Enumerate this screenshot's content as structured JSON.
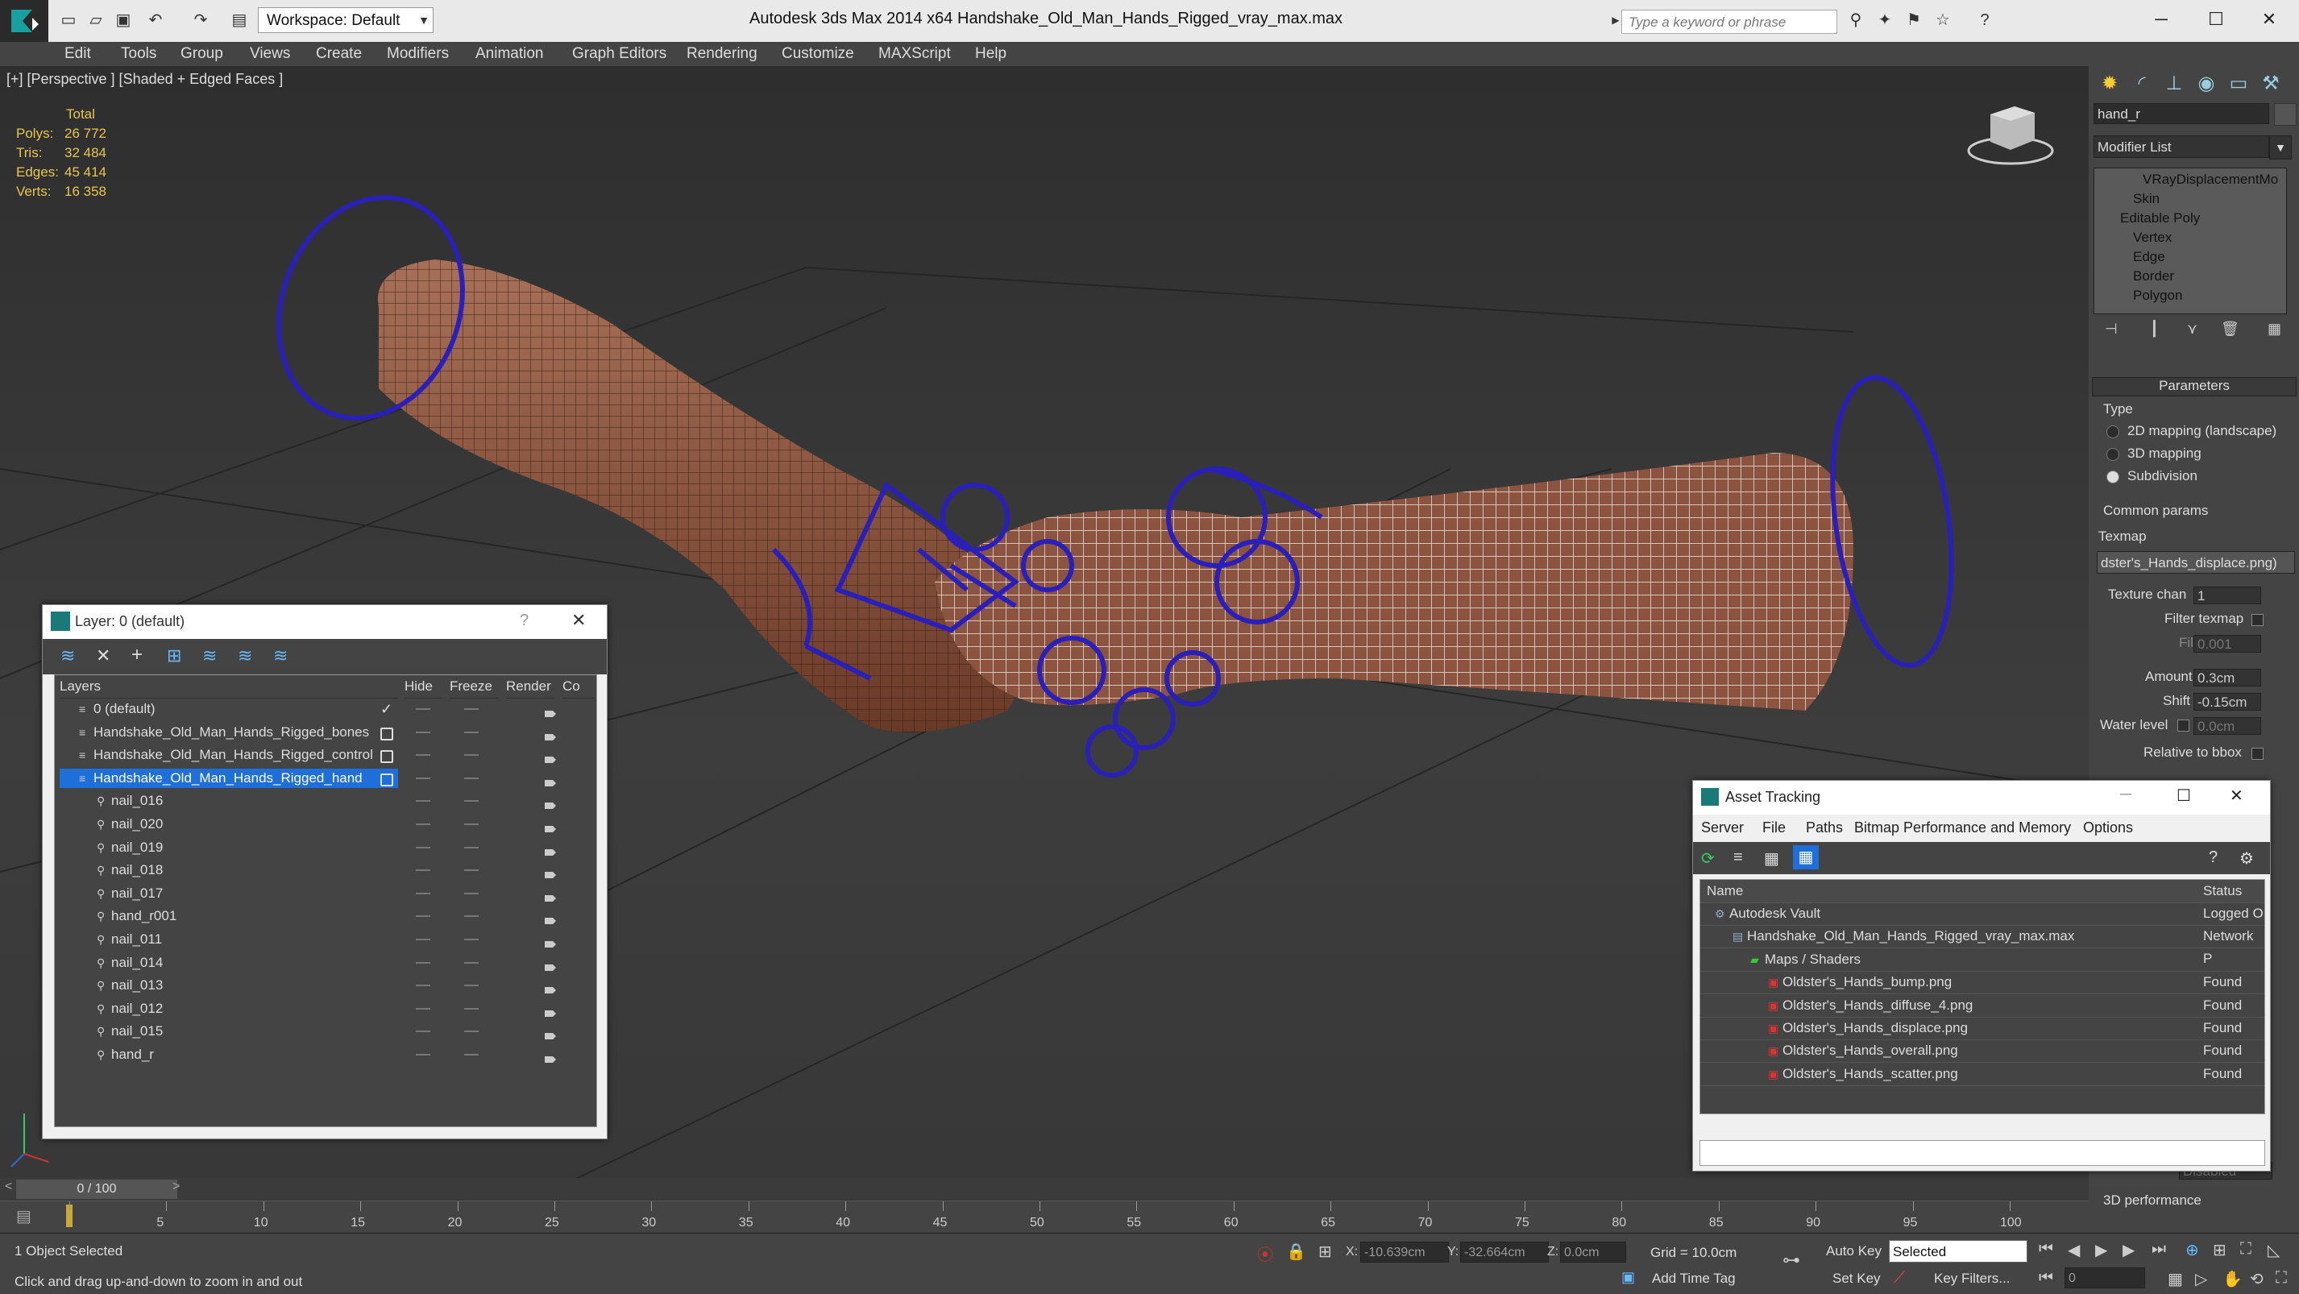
{
  "window": {
    "app_title": "Autodesk 3ds Max  2014 x64",
    "file_title": "Handshake_Old_Man_Hands_Rigged_vray_max.max",
    "workspace_label": "Workspace: Default",
    "search_placeholder": "Type a keyword or phrase"
  },
  "menu": [
    "Edit",
    "Tools",
    "Group",
    "Views",
    "Create",
    "Modifiers",
    "Animation",
    "Graph Editors",
    "Rendering",
    "Customize",
    "MAXScript",
    "Help"
  ],
  "viewport": {
    "label": "[+] [Perspective ] [Shaded + Edged Faces ]",
    "stats": {
      "header": "Total",
      "rows": [
        {
          "key": "Polys:",
          "value": "26 772"
        },
        {
          "key": "Tris:",
          "value": "32 484"
        },
        {
          "key": "Edges:",
          "value": "45 414"
        },
        {
          "key": "Verts:",
          "value": "16 358"
        }
      ]
    }
  },
  "command_panel": {
    "object_name": "hand_r",
    "modifier_list": "Modifier List",
    "stack": [
      "VRayDisplacementMo",
      "Skin",
      "Editable Poly",
      "Vertex",
      "Edge",
      "Border",
      "Polygon"
    ],
    "parameters_title": "Parameters",
    "type_label": "Type",
    "type_options": [
      "2D mapping (landscape)",
      "3D mapping",
      "Subdivision"
    ],
    "common_params": "Common params",
    "texmap_label": "Texmap",
    "texmap_value": "dster's_Hands_displace.png)",
    "texture_chan_label": "Texture chan",
    "texture_chan_value": "1",
    "filter_texmap": "Filter texmap",
    "filter_blur_label": "Filter blur",
    "filter_blur_value": "0.001",
    "amount_label": "Amount",
    "amount_value": "0.3cm",
    "shift_label": "Shift",
    "shift_value": "-0.15cm",
    "water_level_label": "Water level",
    "water_level_value": "0.0cm",
    "relative_bbox": "Relative to bbox",
    "disabled_field": "Disabled",
    "perf_label": "3D performance"
  },
  "layer_window": {
    "title": "Layer: 0 (default)",
    "help": "?",
    "columns": [
      "Layers",
      "Hide",
      "Freeze",
      "Render",
      "Co"
    ],
    "rows": [
      {
        "name": "0 (default)",
        "indent": 0,
        "selected": false
      },
      {
        "name": "Handshake_Old_Man_Hands_Rigged_bones",
        "indent": 0,
        "selected": false
      },
      {
        "name": "Handshake_Old_Man_Hands_Rigged_control",
        "indent": 0,
        "selected": false
      },
      {
        "name": "Handshake_Old_Man_Hands_Rigged_hand",
        "indent": 0,
        "selected": true
      },
      {
        "name": "nail_016",
        "indent": 1,
        "selected": false
      },
      {
        "name": "nail_020",
        "indent": 1,
        "selected": false
      },
      {
        "name": "nail_019",
        "indent": 1,
        "selected": false
      },
      {
        "name": "nail_018",
        "indent": 1,
        "selected": false
      },
      {
        "name": "nail_017",
        "indent": 1,
        "selected": false
      },
      {
        "name": "hand_r001",
        "indent": 1,
        "selected": false
      },
      {
        "name": "nail_011",
        "indent": 1,
        "selected": false
      },
      {
        "name": "nail_014",
        "indent": 1,
        "selected": false
      },
      {
        "name": "nail_013",
        "indent": 1,
        "selected": false
      },
      {
        "name": "nail_012",
        "indent": 1,
        "selected": false
      },
      {
        "name": "nail_015",
        "indent": 1,
        "selected": false
      },
      {
        "name": "hand_r",
        "indent": 1,
        "selected": false
      }
    ]
  },
  "asset_window": {
    "title": "Asset Tracking",
    "menu": [
      "Server",
      "File",
      "Paths",
      "Bitmap Performance and Memory",
      "Options"
    ],
    "columns": [
      "Name",
      "Status"
    ],
    "rows": [
      {
        "name": "Autodesk Vault",
        "status": "Logged O",
        "indent": 1
      },
      {
        "name": "Handshake_Old_Man_Hands_Rigged_vray_max.max",
        "status": "Network P",
        "indent": 2
      },
      {
        "name": "Maps / Shaders",
        "status": "",
        "indent": 3
      },
      {
        "name": "Oldster's_Hands_bump.png",
        "status": "Found",
        "indent": 4
      },
      {
        "name": "Oldster's_Hands_diffuse_4.png",
        "status": "Found",
        "indent": 4
      },
      {
        "name": "Oldster's_Hands_displace.png",
        "status": "Found",
        "indent": 4
      },
      {
        "name": "Oldster's_Hands_overall.png",
        "status": "Found",
        "indent": 4
      },
      {
        "name": "Oldster's_Hands_scatter.png",
        "status": "Found",
        "indent": 4
      }
    ]
  },
  "timeline": {
    "frame_label": "0 / 100",
    "ticks": [
      "0",
      "5",
      "10",
      "15",
      "20",
      "25",
      "30",
      "35",
      "40",
      "45",
      "50",
      "55",
      "60",
      "65",
      "70",
      "75",
      "80",
      "85",
      "90",
      "95",
      "100"
    ]
  },
  "status": {
    "selected_text": "1 Object Selected",
    "prompt_text": "Click and drag up-and-down to zoom in and out",
    "x_label": "X:",
    "x_value": "-10.639cm",
    "y_label": "Y:",
    "y_value": "-32.664cm",
    "z_label": "Z:",
    "z_value": "0.0cm",
    "grid": "Grid = 10.0cm",
    "auto_key": "Auto Key",
    "set_key": "Set Key",
    "selected_dropdown": "Selected",
    "key_filters": "Key Filters...",
    "add_time_tag": "Add Time Tag",
    "frame_field": "0"
  },
  "colors": {
    "selection_blue": "#1e6fd9",
    "stats_yellow": "#e8c84a",
    "bone_blue": "#2a1fb8"
  }
}
